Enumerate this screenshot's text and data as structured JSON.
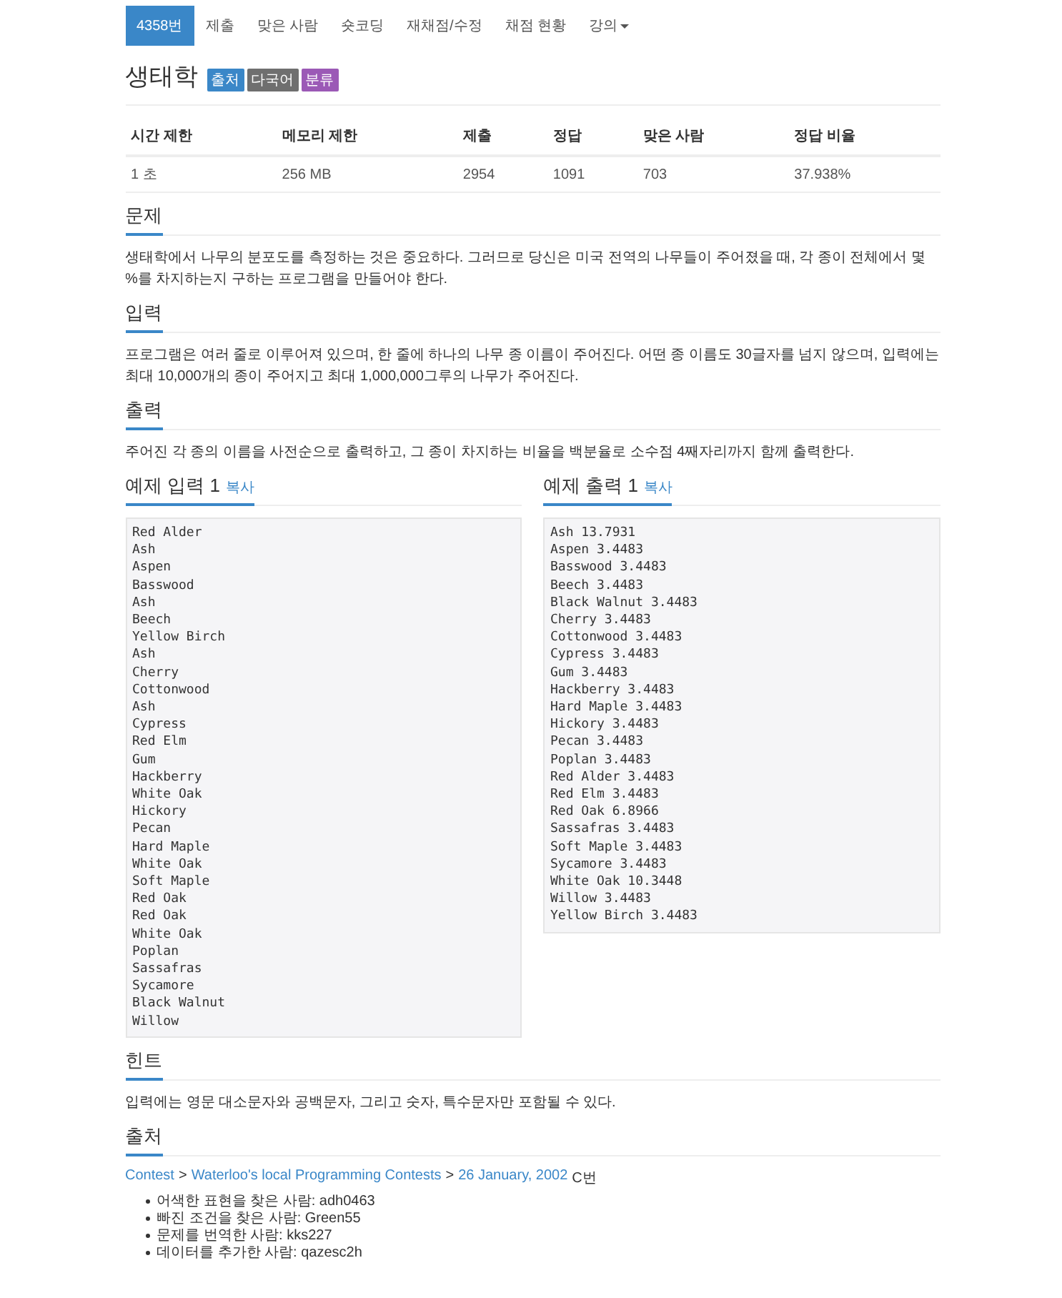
{
  "nav": {
    "tabs": [
      {
        "label": "4358번",
        "selected": true,
        "dropdown": false
      },
      {
        "label": "제출",
        "selected": false,
        "dropdown": false
      },
      {
        "label": "맞은 사람",
        "selected": false,
        "dropdown": false
      },
      {
        "label": "숏코딩",
        "selected": false,
        "dropdown": false
      },
      {
        "label": "재채점/수정",
        "selected": false,
        "dropdown": false
      },
      {
        "label": "채점 현황",
        "selected": false,
        "dropdown": false
      },
      {
        "label": "강의",
        "selected": false,
        "dropdown": true
      }
    ]
  },
  "title": "생태학",
  "labels": [
    {
      "text": "출처",
      "color": "#3a87c8"
    },
    {
      "text": "다국어",
      "color": "#6f6f6f"
    },
    {
      "text": "분류",
      "color": "#9b59b6"
    }
  ],
  "info_table": {
    "columns": [
      "시간 제한",
      "메모리 제한",
      "제출",
      "정답",
      "맞은 사람",
      "정답 비율"
    ],
    "rows": [
      [
        "1 초",
        "256 MB",
        "2954",
        "1091",
        "703",
        "37.938%"
      ]
    ]
  },
  "sections": [
    {
      "title": "문제",
      "text": "생태학에서 나무의 분포도를 측정하는 것은 중요하다. 그러므로 당신은 미국 전역의 나무들이 주어졌을 때, 각 종이 전체에서 몇 %를 차지하는지 구하는 프로그램을 만들어야 한다."
    },
    {
      "title": "입력",
      "text": "프로그램은 여러 줄로 이루어져 있으며, 한 줄에 하나의 나무 종 이름이 주어진다. 어떤 종 이름도 30글자를 넘지 않으며, 입력에는 최대 10,000개의 종이 주어지고 최대 1,000,000그루의 나무가 주어진다."
    },
    {
      "title": "출력",
      "text": "주어진 각 종의 이름을 사전순으로 출력하고, 그 종이 차지하는 비율을 백분율로 소수점 4째자리까지 함께 출력한다."
    }
  ],
  "samples": [
    {
      "title": "예제 입력 1",
      "copy": "복사",
      "lines": [
        "Red Alder",
        "Ash",
        "Aspen",
        "Basswood",
        "Ash",
        "Beech",
        "Yellow Birch",
        "Ash",
        "Cherry",
        "Cottonwood",
        "Ash",
        "Cypress",
        "Red Elm",
        "Gum",
        "Hackberry",
        "White Oak",
        "Hickory",
        "Pecan",
        "Hard Maple",
        "White Oak",
        "Soft Maple",
        "Red Oak",
        "Red Oak",
        "White Oak",
        "Poplan",
        "Sassafras",
        "Sycamore",
        "Black Walnut",
        "Willow"
      ]
    },
    {
      "title": "예제 출력 1",
      "copy": "복사",
      "lines": [
        "Ash 13.7931",
        "Aspen 3.4483",
        "Basswood 3.4483",
        "Beech 3.4483",
        "Black Walnut 3.4483",
        "Cherry 3.4483",
        "Cottonwood 3.4483",
        "Cypress 3.4483",
        "Gum 3.4483",
        "Hackberry 3.4483",
        "Hard Maple 3.4483",
        "Hickory 3.4483",
        "Pecan 3.4483",
        "Poplan 3.4483",
        "Red Alder 3.4483",
        "Red Elm 3.4483",
        "Red Oak 6.8966",
        "Sassafras 3.4483",
        "Soft Maple 3.4483",
        "Sycamore 3.4483",
        "White Oak 10.3448",
        "Willow 3.4483",
        "Yellow Birch 3.4483"
      ]
    }
  ],
  "hint": {
    "title": "힌트",
    "text": "입력에는 영문 대소문자와 공백문자, 그리고 숫자, 특수문자만 포함될 수 있다."
  },
  "source": {
    "title": "출처",
    "breadcrumb": [
      {
        "text": "Contest",
        "link": true
      },
      {
        "text": ">",
        "link": false
      },
      {
        "text": "Waterloo's local Programming Contests",
        "link": true
      },
      {
        "text": ">",
        "link": false
      },
      {
        "text": "26 January, 2002",
        "link": true
      },
      {
        "text": "C번",
        "link": false
      }
    ],
    "credits": [
      "어색한 표현을 찾은 사람: adh0463",
      "빠진 조건을 찾은 사람: Green55",
      "문제를 번역한 사람: kks227",
      "데이터를 추가한 사람: qazesc2h"
    ]
  }
}
